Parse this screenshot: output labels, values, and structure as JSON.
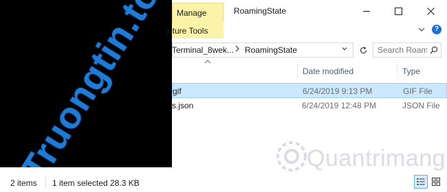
{
  "watermark": {
    "site": "Truongtin.top",
    "brand": "Quantrimang"
  },
  "ribbon": {
    "manage_tab": "Manage",
    "picture_tools": "icture Tools",
    "help_icon": "?"
  },
  "window": {
    "title": "RoamingState"
  },
  "address": {
    "crumbs": [
      "Terminal_8wek...",
      "RoamingState"
    ],
    "search_placeholder": "Search Roami..."
  },
  "columns": {
    "date": "Date modified",
    "type": "Type"
  },
  "rows": [
    {
      "name": "gif",
      "date": "6/24/2019 9:13 PM",
      "type": "GIF File",
      "selected": true
    },
    {
      "name": "s.json",
      "date": "6/24/2019 12:48 PM",
      "type": "JSON File",
      "selected": false
    }
  ],
  "status": {
    "items": "2 items",
    "selected": "1 item selected",
    "size": "28.3 KB"
  },
  "icons": {
    "window": [
      "minimize-icon",
      "maximize-icon",
      "close-icon"
    ],
    "ribbon": [
      "chevron-down-icon",
      "help-icon"
    ],
    "address": [
      "chevron-right-icon",
      "chevron-down-icon",
      "refresh-icon",
      "search-icon"
    ],
    "views": [
      "details-view-icon",
      "large-icons-view-icon"
    ]
  },
  "colors": {
    "selection_fill": "#cce8ff",
    "selection_border": "#99d1ff",
    "manage_tab": "#fbf3a8",
    "watermark_blue": "#1e7bd6",
    "header_text": "#4c607a"
  }
}
